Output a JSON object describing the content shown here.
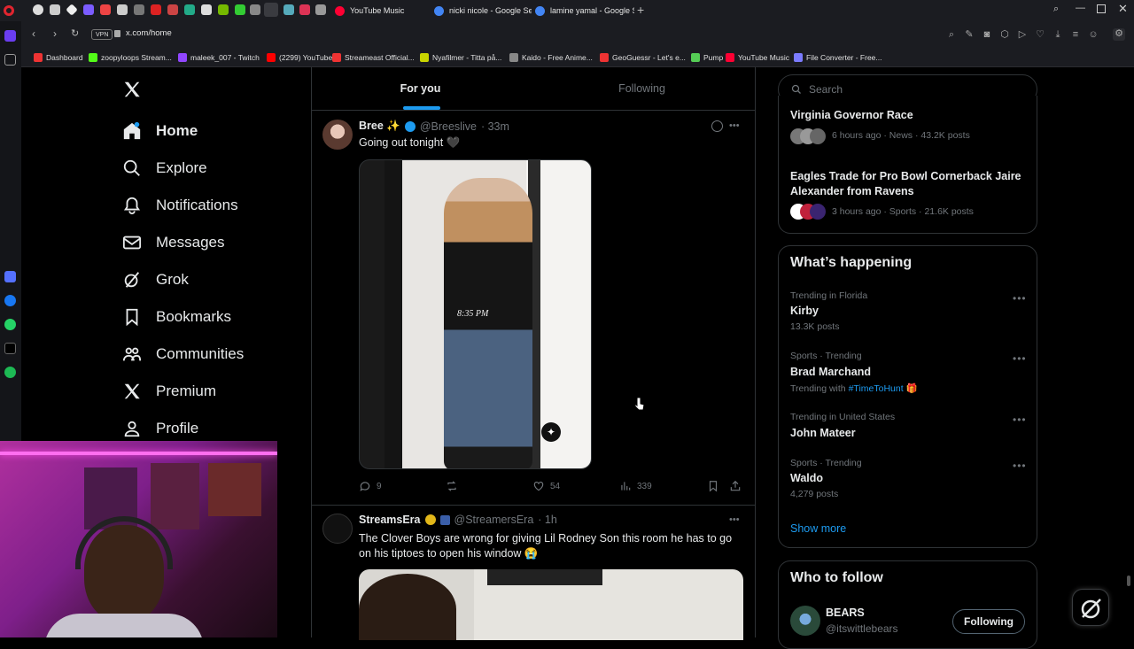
{
  "browser": {
    "tabs": [
      {
        "label": "YouTube Music",
        "color": "#ff0033"
      },
      {
        "label": "nicki nicole - Google Sear",
        "color": "#4285f4"
      },
      {
        "label": "lamine yamal - Google Sea",
        "color": "#4285f4"
      }
    ],
    "address": "x.com/home",
    "vpn_label": "VPN",
    "bookmarks": [
      {
        "label": "Dashboard",
        "color": "#e33"
      },
      {
        "label": "zoopyloops Stream...",
        "color": "#53fc18"
      },
      {
        "label": "maleek_007 - Twitch",
        "color": "#9146ff"
      },
      {
        "label": "(2299) YouTube",
        "color": "#ff0000"
      },
      {
        "label": "Streameast Official...",
        "color": "#e33"
      },
      {
        "label": "Nyafilmer - Titta på...",
        "color": "#c8d400"
      },
      {
        "label": "Kaido - Free Anime...",
        "color": "#888"
      },
      {
        "label": "GeoGuessr - Let's e...",
        "color": "#e33"
      },
      {
        "label": "Pump",
        "color": "#5c5"
      },
      {
        "label": "YouTube Music",
        "color": "#ff0033"
      },
      {
        "label": "File Converter - Free...",
        "color": "#7b7bff"
      }
    ]
  },
  "nav": {
    "items": [
      {
        "label": "Home"
      },
      {
        "label": "Explore"
      },
      {
        "label": "Notifications"
      },
      {
        "label": "Messages"
      },
      {
        "label": "Grok"
      },
      {
        "label": "Bookmarks"
      },
      {
        "label": "Communities"
      },
      {
        "label": "Premium"
      },
      {
        "label": "Profile"
      }
    ]
  },
  "feed": {
    "tabs": [
      "For you",
      "Following"
    ],
    "post1": {
      "name": "Bree ✨",
      "handle": "@Breeslive",
      "time": "· 33m",
      "text": "Going out tonight 🖤",
      "media_caption": "8:35 PM",
      "replies": "9",
      "reposts": "",
      "likes": "54",
      "views": "339"
    },
    "post2": {
      "name": "StreamsEra",
      "handle": "@StreamersEra",
      "time": "· 1h",
      "text": "The Clover Boys are wrong for giving Lil Rodney Son this room he has to go on his tiptoes to open his window 😭"
    }
  },
  "right": {
    "search_placeholder": "Search",
    "news": [
      {
        "title": "Virginia Governor Race",
        "meta": "6 hours ago · News · 43.2K posts"
      },
      {
        "title": "Eagles Trade for Pro Bowl Cornerback Jaire Alexander from Ravens",
        "meta": "3 hours ago · Sports · 21.6K posts"
      }
    ],
    "happening_title": "What’s happening",
    "trends": [
      {
        "context": "Trending in Florida",
        "name": "Kirby",
        "sub": "13.3K posts"
      },
      {
        "context": "Sports · Trending",
        "name": "Brad Marchand",
        "sub": "Trending with",
        "hashtag": "#TimeToHunt"
      },
      {
        "context": "Trending in United States",
        "name": "John Mateer",
        "sub": ""
      },
      {
        "context": "Sports · Trending",
        "name": "Waldo",
        "sub": "4,279 posts"
      }
    ],
    "show_more": "Show more",
    "who_to_follow_title": "Who to follow",
    "follow": {
      "name": "BEARS",
      "handle": "@itswittlebears",
      "button": "Following"
    }
  },
  "colors": {
    "accent": "#1d9bf0",
    "bg": "#000000",
    "border": "#2f3336",
    "muted": "#71767b"
  }
}
